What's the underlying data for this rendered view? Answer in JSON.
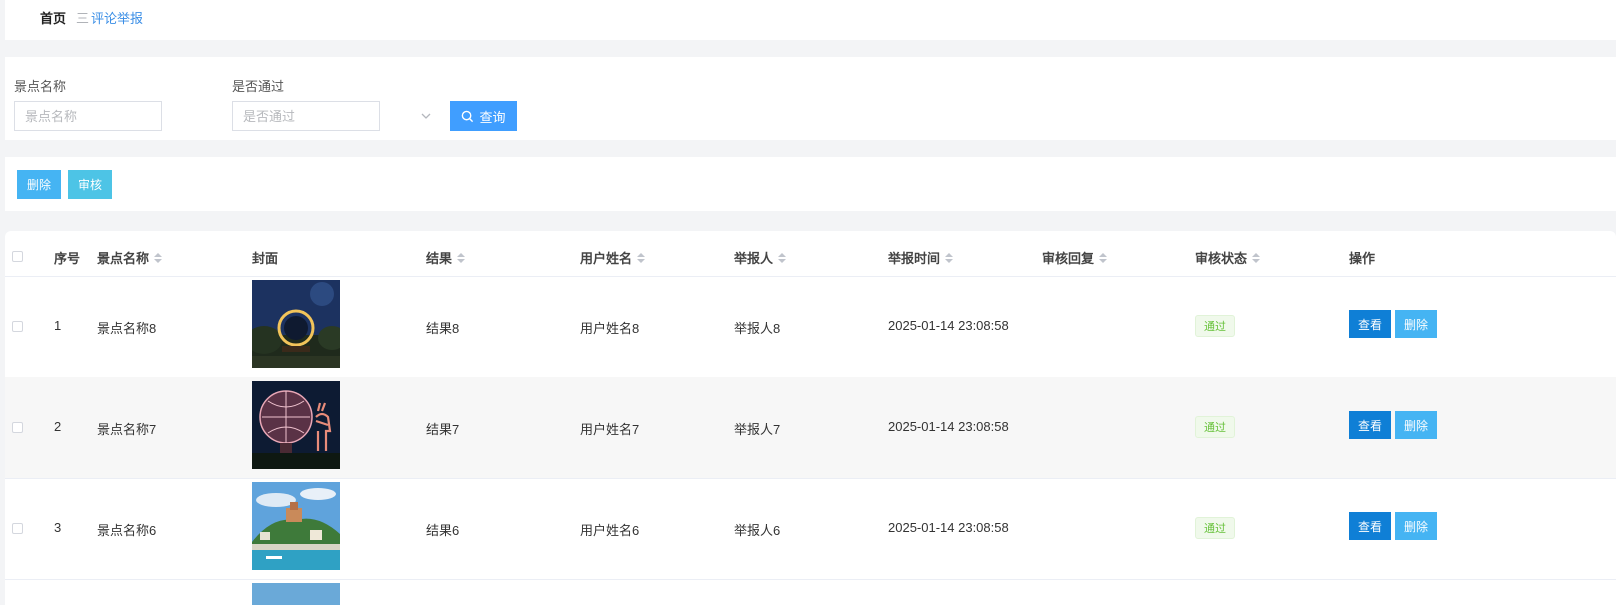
{
  "breadcrumb": {
    "home": "首页",
    "separator": "三",
    "current": "评论举报"
  },
  "search": {
    "spot_name_label": "景点名称",
    "spot_name_placeholder": "景点名称",
    "passed_label": "是否通过",
    "passed_placeholder": "是否通过",
    "search_button": "查询"
  },
  "actions": {
    "delete": "删除",
    "audit": "审核"
  },
  "colors": {
    "primary": "#409eff",
    "view_button": "#0f7fd6",
    "delete_button": "#45b4f3",
    "audit_button": "#4dc4e6",
    "tag_green": "#67c23a"
  },
  "table": {
    "columns": {
      "index": "序号",
      "spot_name": "景点名称",
      "cover": "封面",
      "result": "结果",
      "user_name": "用户姓名",
      "reporter": "举报人",
      "report_time": "举报时间",
      "audit_reply": "审核回复",
      "audit_status": "审核状态",
      "operation": "操作"
    },
    "rows": [
      {
        "index": "1",
        "spot_name": "景点名称8",
        "cover": "night-park-ring-sculpture",
        "result": "结果8",
        "user_name": "用户姓名8",
        "reporter": "举报人8",
        "report_time": "2025-01-14 23:08:58",
        "audit_reply": "",
        "audit_status": "通过",
        "view": "查看",
        "delete": "删除"
      },
      {
        "index": "2",
        "spot_name": "景点名称7",
        "cover": "lantern-globe-and-deer",
        "result": "结果7",
        "user_name": "用户姓名7",
        "reporter": "举报人7",
        "report_time": "2025-01-14 23:08:58",
        "audit_reply": "",
        "audit_status": "通过",
        "view": "查看",
        "delete": "删除"
      },
      {
        "index": "3",
        "spot_name": "景点名称6",
        "cover": "seaside-hill-town",
        "result": "结果6",
        "user_name": "用户姓名6",
        "reporter": "举报人6",
        "report_time": "2025-01-14 23:08:58",
        "audit_reply": "",
        "audit_status": "通过",
        "view": "查看",
        "delete": "删除"
      }
    ]
  }
}
